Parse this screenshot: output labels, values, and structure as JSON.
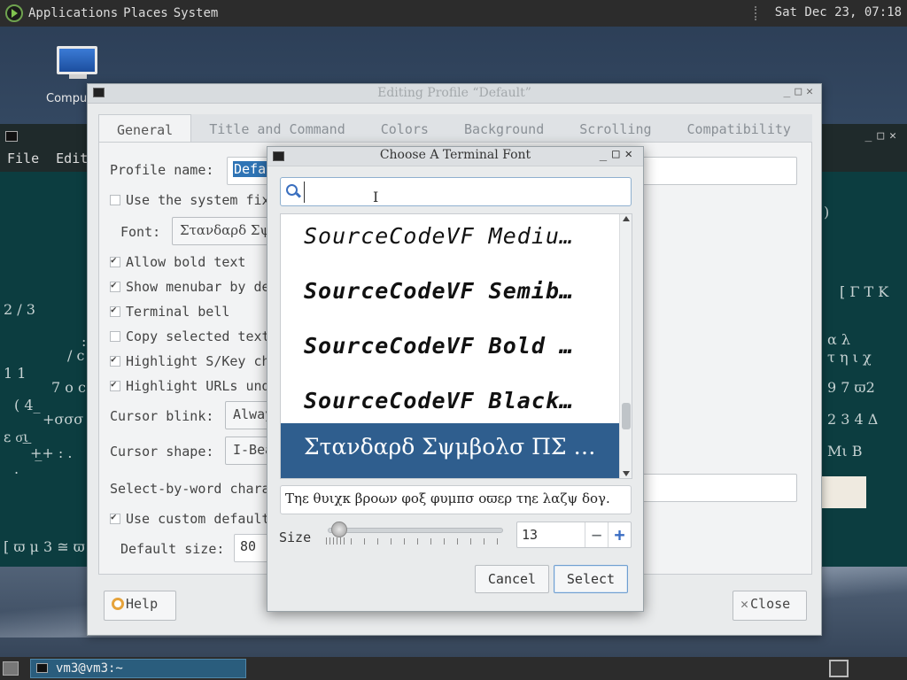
{
  "top_panel": {
    "menus": [
      "Applications",
      "Places",
      "System"
    ],
    "clock": "Sat Dec 23, 07:18"
  },
  "desktop": {
    "icon_label": "Compu"
  },
  "terminal": {
    "menu": [
      "File",
      "Edit"
    ],
    "glyphs": [
      {
        "t": "2 / 3"
      },
      {
        "t": "1 1"
      },
      {
        "t": ": "
      },
      {
        "t": "/ c"
      },
      {
        "t": "7 o c"
      },
      {
        "t": "( 4_"
      },
      {
        "t": "+σσσ"
      },
      {
        "t": "ε σ͟ι"
      },
      {
        "t": "+̲+ : ."
      },
      {
        "t": "."
      },
      {
        "t": "[ ϖ μ 3 ≅ ϖ"
      },
      {
        "t": ")"
      },
      {
        "t": "[ Γ Τ Κ"
      },
      {
        "t": "α λ"
      },
      {
        "t": "τ η ι χ"
      },
      {
        "t": "9 7   ϖ2"
      },
      {
        "t": "2 3 4   Δ"
      },
      {
        "t": "Μι Β"
      }
    ]
  },
  "profile_window": {
    "title": "Editing Profile “Default”",
    "tabs": [
      "General",
      "Title and Command",
      "Colors",
      "Background",
      "Scrolling",
      "Compatibility"
    ],
    "profile_name_label": "Profile name:",
    "profile_name_value": "Defau",
    "use_system_font_label": "Use the system fix",
    "font_label": "Font:",
    "font_button": "Στανδαρδ Σψ",
    "allow_bold_label": "Allow bold text",
    "show_menubar_label": "Show menubar by de",
    "terminal_bell_label": "Terminal bell",
    "copy_selected_label": "Copy selected text",
    "highlight_skey_label": "Highlight S/Key ch",
    "highlight_urls_label": "Highlight URLs und",
    "cursor_blink_label": "Cursor blink:",
    "cursor_blink_value": "Alway",
    "cursor_shape_label": "Cursor shape:",
    "cursor_shape_value": "I-Bea",
    "select_by_word_label": "Select-by-word chara",
    "use_custom_default_label": "Use custom default",
    "default_size_label": "Default size:",
    "default_size_value": "80",
    "help_button": "Help",
    "close_button": "Close"
  },
  "font_dialog": {
    "title": "Choose A Terminal Font",
    "search_placeholder": "",
    "fonts": [
      "SourceCodeVF Mediu…",
      "SourceCodeVF Semib…",
      "SourceCodeVF Bold …",
      "SourceCodeVF Black…",
      "Στανδαρδ Σψμβολσ ΠΣ …"
    ],
    "preview_text": "Τηε θυιχκ βροων φοξ φυμπσ οϖερ τηε λαζψ δογ.",
    "size_label": "Size",
    "size_value": "13",
    "cancel_button": "Cancel",
    "select_button": "Select"
  },
  "bottom_panel": {
    "task_label": "vm3@vm3:~"
  }
}
